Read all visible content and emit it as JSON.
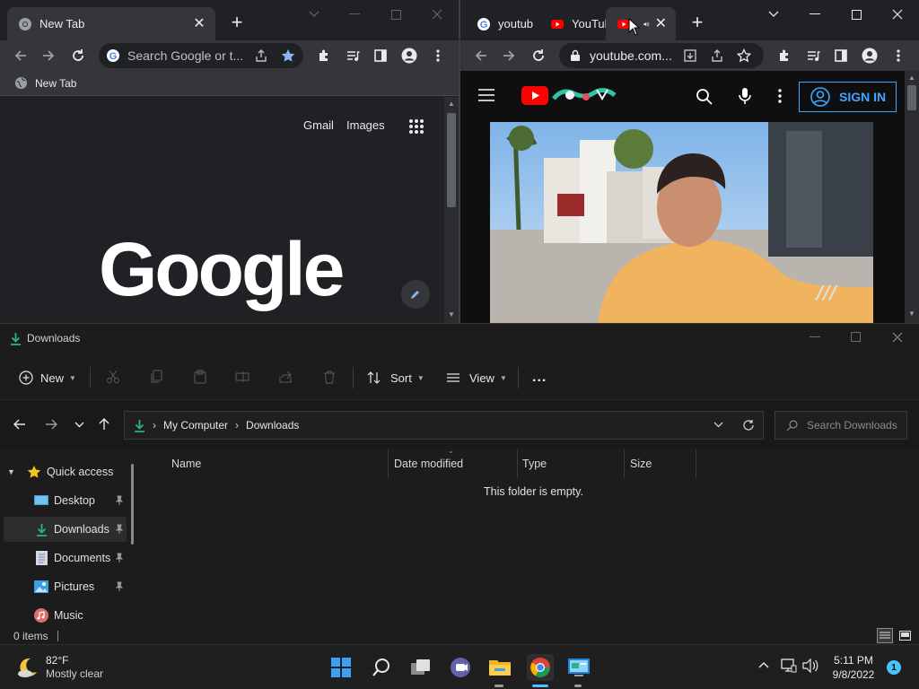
{
  "left_window": {
    "tab_title": "New Tab",
    "omnibox_placeholder": "Search Google or t...",
    "bookmark_label": "New Tab",
    "ntp": {
      "link_gmail": "Gmail",
      "link_images": "Images",
      "logo_text": "Google"
    }
  },
  "right_window": {
    "tabs": [
      {
        "title": "youtub"
      },
      {
        "title": "YouTul"
      }
    ],
    "url": "youtube.com...",
    "sign_in_label": "SIGN IN"
  },
  "explorer": {
    "title": "Downloads",
    "command_bar": {
      "new_label": "New",
      "sort_label": "Sort",
      "view_label": "View",
      "more_label": "..."
    },
    "breadcrumb": [
      "My Computer",
      "Downloads"
    ],
    "search_placeholder": "Search Downloads",
    "sidebar": [
      {
        "label": "Quick access",
        "icon": "star-icon"
      },
      {
        "label": "Desktop",
        "icon": "desktop-icon"
      },
      {
        "label": "Downloads",
        "icon": "download-icon"
      },
      {
        "label": "Documents",
        "icon": "documents-icon"
      },
      {
        "label": "Pictures",
        "icon": "pictures-icon"
      },
      {
        "label": "Music",
        "icon": "music-icon"
      }
    ],
    "columns": [
      "Name",
      "Date modified",
      "Type",
      "Size"
    ],
    "empty_message": "This folder is empty.",
    "status": "0 items"
  },
  "taskbar": {
    "weather": {
      "temp": "82°F",
      "condition": "Mostly clear"
    },
    "time": "5:11 PM",
    "date": "9/8/2022",
    "notification_count": "1"
  },
  "colors": {
    "youtube_red": "#ff0000",
    "accent_blue": "#3ea6ff",
    "windows_blue": "#0078d4",
    "download_green": "#2fb380"
  }
}
